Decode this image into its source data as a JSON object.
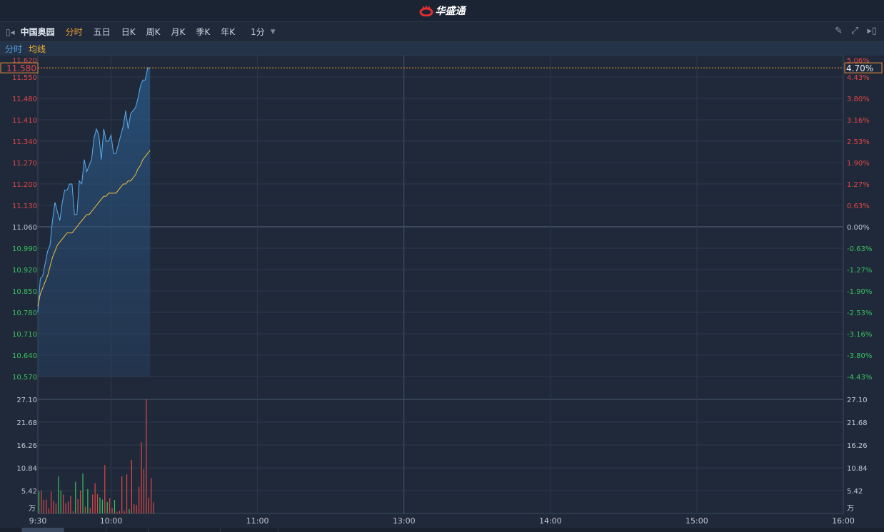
{
  "header": {
    "app_name": "华盛通"
  },
  "toolbar": {
    "stock_name": "中国奥园",
    "tabs": [
      "分时",
      "五日",
      "日K",
      "周K",
      "月K",
      "季K",
      "年K"
    ],
    "active_tab": 0,
    "period": "1分"
  },
  "legend": {
    "price_label": "分时",
    "avg_label": "均线"
  },
  "colors": {
    "price_line": "#5aaef0",
    "avg_line": "#f0c040",
    "up": "#e04848",
    "down": "#3cc060",
    "current": "#e8903a"
  },
  "current": {
    "price": "11.580",
    "change_pct": "4.70%"
  },
  "chart_data": {
    "type": "line",
    "title": "中国奥园 分时",
    "prev_close": 11.06,
    "price_ylim": [
      10.57,
      11.62
    ],
    "price_ticks": [
      "11.620",
      "11.550",
      "11.480",
      "11.410",
      "11.340",
      "11.270",
      "11.200",
      "11.130",
      "11.060",
      "10.990",
      "10.920",
      "10.850",
      "10.780",
      "10.710",
      "10.640",
      "10.570"
    ],
    "pct_ticks": [
      "5.06%",
      "4.43%",
      "3.80%",
      "3.16%",
      "2.53%",
      "1.90%",
      "1.27%",
      "0.63%",
      "0.00%",
      "-0.63%",
      "-1.27%",
      "-1.90%",
      "-2.53%",
      "-3.16%",
      "-3.80%",
      "-4.43%"
    ],
    "volume_ylim": [
      0,
      27.1
    ],
    "volume_ticks": [
      "27.10",
      "21.68",
      "16.26",
      "10.84",
      "5.42"
    ],
    "volume_unit": "万",
    "time_ticks": [
      "9:30",
      "10:00",
      "11:00",
      "13:00",
      "14:00",
      "15:00",
      "16:00"
    ],
    "time_tick_minutes": [
      0,
      30,
      90,
      150,
      210,
      270,
      330
    ],
    "total_minutes": 330,
    "series": [
      {
        "name": "分时",
        "values": [
          10.78,
          10.89,
          10.9,
          10.94,
          10.98,
          11.0,
          11.08,
          11.14,
          11.11,
          11.08,
          11.14,
          11.18,
          11.18,
          11.2,
          11.2,
          11.1,
          11.1,
          11.21,
          11.2,
          11.28,
          11.24,
          11.26,
          11.28,
          11.35,
          11.38,
          11.36,
          11.28,
          11.38,
          11.34,
          11.34,
          11.36,
          11.3,
          11.3,
          11.33,
          11.36,
          11.39,
          11.44,
          11.38,
          11.43,
          11.44,
          11.45,
          11.48,
          11.52,
          11.54,
          11.54,
          11.58,
          11.58
        ]
      },
      {
        "name": "均线",
        "values": [
          10.8,
          10.84,
          10.86,
          10.88,
          10.9,
          10.93,
          10.96,
          10.98,
          11.0,
          11.01,
          11.02,
          11.03,
          11.04,
          11.04,
          11.04,
          11.05,
          11.06,
          11.07,
          11.08,
          11.09,
          11.1,
          11.1,
          11.11,
          11.12,
          11.13,
          11.14,
          11.15,
          11.16,
          11.16,
          11.17,
          11.17,
          11.17,
          11.17,
          11.18,
          11.19,
          11.2,
          11.2,
          11.21,
          11.21,
          11.22,
          11.23,
          11.25,
          11.26,
          11.28,
          11.29,
          11.3,
          11.31
        ]
      }
    ],
    "volume": [
      5.3,
      5.5,
      3.2,
      3.3,
      1.2,
      5.2,
      3.0,
      2.4,
      8.8,
      5.4,
      4.5,
      2.4,
      2.8,
      4.2,
      0.5,
      7.5,
      3.4,
      5.5,
      9.5,
      1.6,
      5.8,
      1.3,
      4.5,
      7.2,
      4.6,
      3.8,
      3.3,
      11.5,
      2.7,
      3.6,
      1.3,
      3.2,
      0.4,
      0.6,
      8.8,
      0.6,
      9.3,
      1.0,
      12.7,
      2.2,
      2.0,
      6.3,
      16.9,
      10.5,
      27.1,
      3.8,
      8.4,
      2.6
    ],
    "volume_up": [
      0,
      1,
      1,
      1,
      1,
      1,
      1,
      1,
      0,
      0,
      1,
      1,
      1,
      1,
      1,
      0,
      1,
      1,
      0,
      1,
      0,
      1,
      1,
      1,
      1,
      0,
      0,
      1,
      0,
      1,
      1,
      0,
      1,
      1,
      1,
      1,
      1,
      0,
      1,
      1,
      1,
      1,
      1,
      1,
      1,
      1,
      1,
      1
    ]
  }
}
